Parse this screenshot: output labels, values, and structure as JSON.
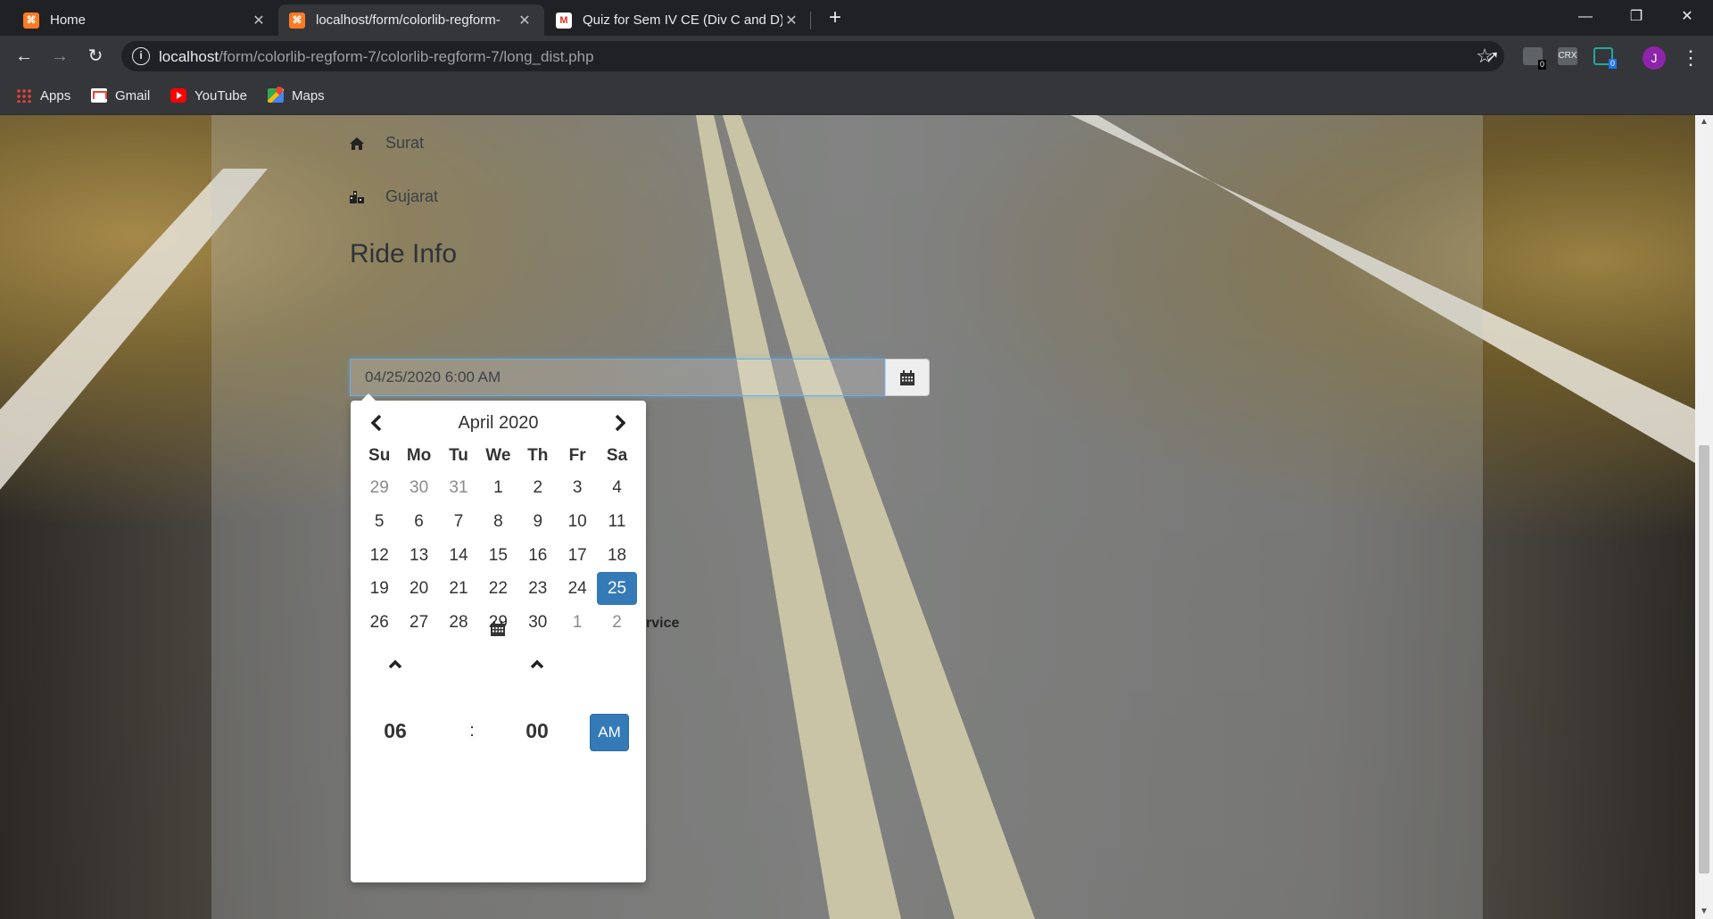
{
  "browser": {
    "tabs": [
      {
        "title": "Home"
      },
      {
        "title": "localhost/form/colorlib-regform-"
      },
      {
        "title": "Quiz for Sem IV CE (Div C and D)"
      }
    ],
    "new_tab_label": "+",
    "url_host": "localhost",
    "url_path": "/form/colorlib-regform-7/colorlib-regform-7/long_dist.php",
    "profile_initial": "J",
    "extensions": [
      {
        "label": "",
        "badge": "0"
      },
      {
        "label": "CRX",
        "badge": ""
      },
      {
        "label": "",
        "badge": "0"
      }
    ]
  },
  "bookmarks": [
    {
      "label": "Apps",
      "icon": "apps-grid-icon"
    },
    {
      "label": "Gmail",
      "icon": "gmail-icon"
    },
    {
      "label": "YouTube",
      "icon": "youtube-icon"
    },
    {
      "label": "Maps",
      "icon": "maps-icon"
    }
  ],
  "page": {
    "city": "Surat",
    "state": "Gujarat",
    "section_title": "Ride Info",
    "datetime_value": "04/25/2020 6:00 AM",
    "partial_label": "rvice"
  },
  "datepicker": {
    "month_label": "April 2020",
    "weekdays": [
      "Su",
      "Mo",
      "Tu",
      "We",
      "Th",
      "Fr",
      "Sa"
    ],
    "weeks": [
      [
        "29",
        "30",
        "31",
        "1",
        "2",
        "3",
        "4"
      ],
      [
        "5",
        "6",
        "7",
        "8",
        "9",
        "10",
        "11"
      ],
      [
        "12",
        "13",
        "14",
        "15",
        "16",
        "17",
        "18"
      ],
      [
        "19",
        "20",
        "21",
        "22",
        "23",
        "24",
        "25"
      ],
      [
        "26",
        "27",
        "28",
        "29",
        "30",
        "1",
        "2"
      ]
    ],
    "muted_days": [
      [
        0,
        0
      ],
      [
        0,
        1
      ],
      [
        0,
        2
      ],
      [
        4,
        5
      ],
      [
        4,
        6
      ]
    ],
    "selected_day": [
      3,
      6
    ],
    "hour": "06",
    "separator": ":",
    "minute": "00",
    "period": "AM"
  },
  "colors": {
    "accent": "#337ab7",
    "chrome_dark": "#202124",
    "chrome_toolbar": "#35363a"
  }
}
